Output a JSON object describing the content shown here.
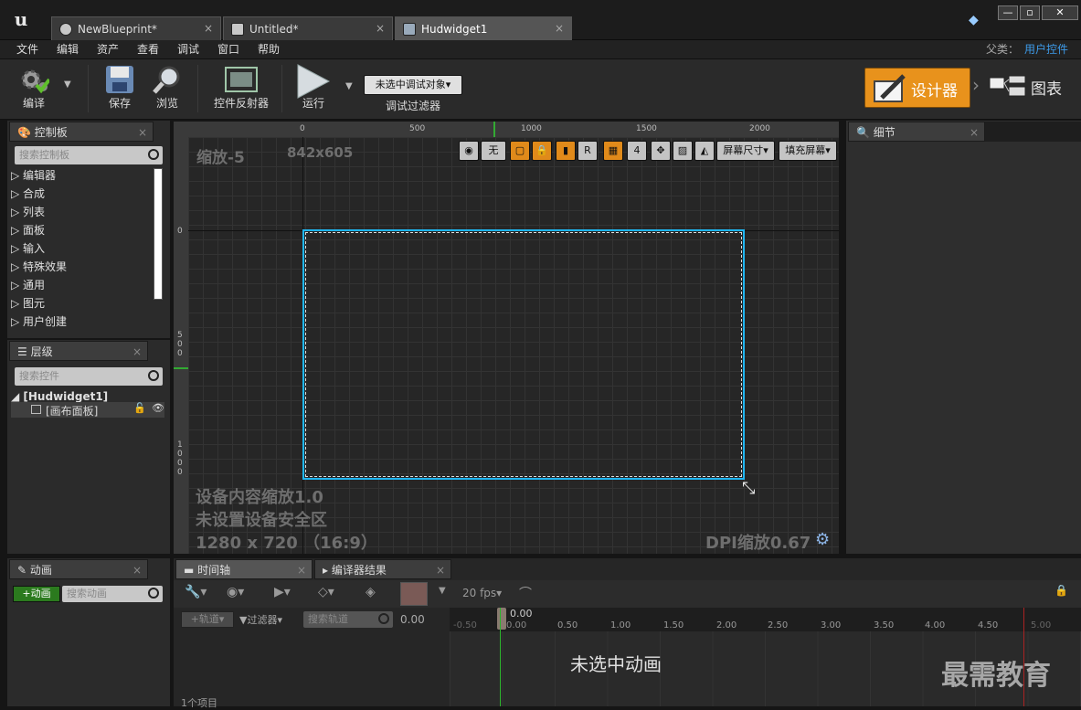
{
  "window": {
    "tabs": [
      {
        "label": "NewBlueprint*"
      },
      {
        "label": "Untitled*"
      },
      {
        "label": "Hudwidget1"
      }
    ],
    "close_glyph": "×",
    "controls": {
      "minimize": "—",
      "maximize": "▫",
      "close": "✕"
    }
  },
  "menu": {
    "items": [
      "文件",
      "编辑",
      "资产",
      "查看",
      "调试",
      "窗口",
      "帮助"
    ],
    "parent_class_label": "父类：",
    "parent_class_value": "用户控件"
  },
  "toolbar": {
    "compile_label": "编译",
    "save_label": "保存",
    "browse_label": "浏览",
    "reflector_label": "控件反射器",
    "run_label": "运行",
    "debug_dropdown": "未选中调试对象▾",
    "debug_filter_label": "调试过滤器",
    "designer_label": "设计器",
    "graph_label": "图表",
    "accent_color": "#e8921c"
  },
  "palette": {
    "title": "控制板",
    "search_placeholder": "搜索控制板",
    "items": [
      "编辑器",
      "合成",
      "列表",
      "面板",
      "输入",
      "特殊效果",
      "通用",
      "图元",
      "用户创建"
    ]
  },
  "hierarchy": {
    "title": "层级",
    "search_placeholder": "搜索控件",
    "root": "[Hudwidget1]",
    "child": "[画布面板]"
  },
  "designer": {
    "zoom_label": "缩放-5",
    "resolution": "842x605",
    "ruler_top": [
      "0",
      "500",
      "1000",
      "1500",
      "2000"
    ],
    "ruler_left": [
      "0",
      "5",
      "0",
      "0",
      "1",
      "0",
      "0",
      "0"
    ],
    "vp_none": "无",
    "vp_r": "R",
    "vp_grid_snap": "4",
    "vp_screen_size": "屏幕尺寸▾",
    "vp_fill_screen": "填充屏幕▾",
    "device_scale": "设备内容缩放1.0",
    "safe_zone": "未设置设备安全区",
    "device_res": "1280 x 720 （16:9）",
    "dpi_scale": "DPI缩放0.67",
    "selection_color": "#1fb6f2"
  },
  "details": {
    "title": "细节"
  },
  "animations": {
    "title": "动画",
    "add_button": "+动画",
    "search_placeholder": "搜索动画"
  },
  "timeline": {
    "tab_timeline": "时间轴",
    "tab_compiler": "编译器结果",
    "fps": "20 fps▾",
    "track_button": "+轨道▾",
    "filter_button": "▼过滤器▾",
    "search_placeholder": "搜索轨道",
    "time_value": "0.00",
    "playhead": "0.00",
    "ticks": [
      "-0.50",
      "0.00",
      "0.50",
      "1.00",
      "1.50",
      "2.00",
      "2.50",
      "3.00",
      "3.50",
      "4.00",
      "4.50",
      "5.00"
    ],
    "empty_message": "未选中动画",
    "item_count": "1个项目"
  },
  "watermark": "最需教育"
}
